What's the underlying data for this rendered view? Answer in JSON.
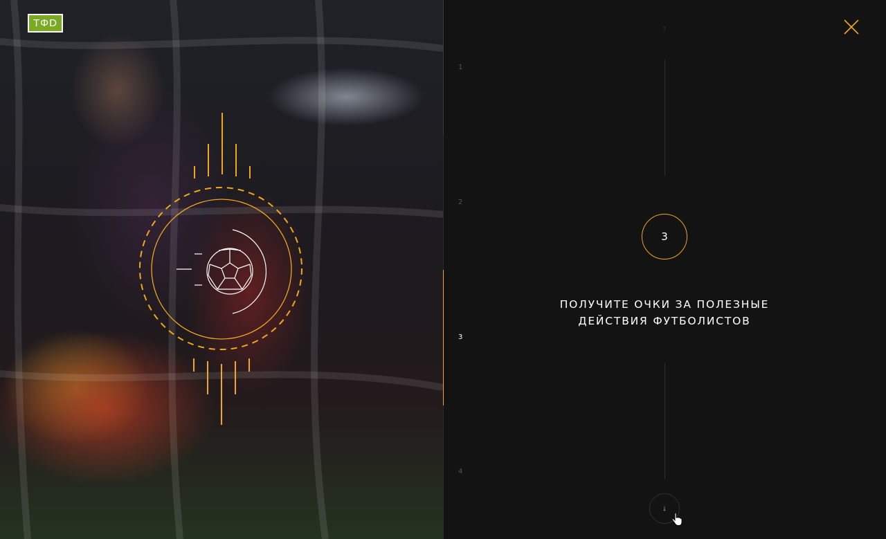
{
  "logo": {
    "text": "TΦD"
  },
  "emblem": {
    "icon": "soccer-ball-icon",
    "accent": "#f2a81d"
  },
  "nav": {
    "steps": [
      {
        "label": "1",
        "active": false
      },
      {
        "label": "2",
        "active": false
      },
      {
        "label": "3",
        "active": true
      },
      {
        "label": "4",
        "active": false
      }
    ],
    "up_icon": "↑",
    "down_icon": "↓",
    "close_icon": "close-icon"
  },
  "slide": {
    "number": "3",
    "headline": "ПОЛУЧИТЕ ОЧКИ ЗА ПОЛЕЗНЫЕ\nДЕЙСТВИЯ  ФУТБОЛИСТОВ"
  },
  "colors": {
    "accent": "#f2a81d",
    "logo_green": "#7aaa24",
    "panel_bg": "#131313"
  }
}
